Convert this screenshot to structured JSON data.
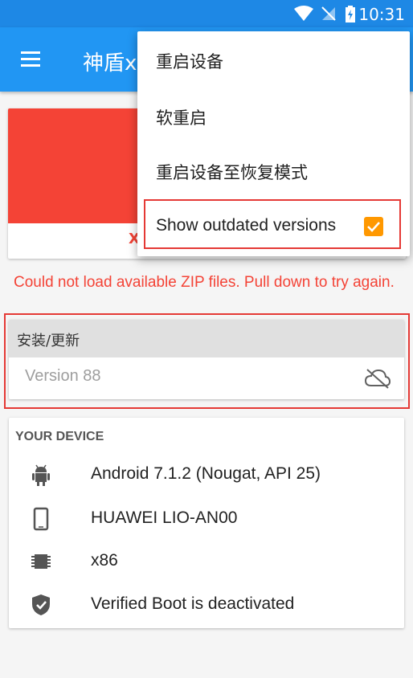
{
  "status_bar": {
    "time": "10:31",
    "icons": [
      "wifi-icon",
      "no-sim-icon",
      "battery-charging-icon"
    ]
  },
  "app_bar": {
    "title": "神盾x",
    "menu_icon": "hamburger-menu-icon"
  },
  "error_message": "Could not load available ZIP files. Pull down to try again.",
  "install_card": {
    "header": "安装/更新",
    "version": "Version 88",
    "status_icon": "cloud-off-icon"
  },
  "device": {
    "title": "YOUR DEVICE",
    "rows": [
      {
        "icon": "android-icon",
        "text": "Android 7.1.2 (Nougat, API 25)"
      },
      {
        "icon": "phone-icon",
        "text": "HUAWEI LIO-AN00"
      },
      {
        "icon": "chip-icon",
        "text": "x86"
      },
      {
        "icon": "shield-check-icon",
        "text": "Verified Boot is deactivated"
      }
    ]
  },
  "overflow_menu": {
    "items": [
      {
        "label": "重启设备"
      },
      {
        "label": "软重启"
      },
      {
        "label": "重启设备至恢复模式"
      },
      {
        "label": "Show outdated versions",
        "checked": true
      }
    ]
  },
  "card_partial_text": "X",
  "colors": {
    "primary": "#2196f3",
    "status_bar": "#1e88e5",
    "error": "#f44336",
    "checkbox": "#ff9800",
    "highlight": "#e53935"
  }
}
